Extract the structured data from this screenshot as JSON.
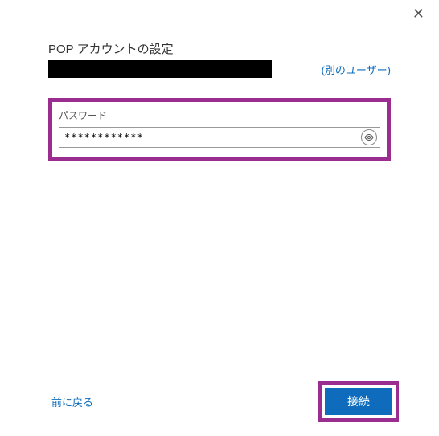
{
  "close_label": "✕",
  "title": "POP アカウントの設定",
  "other_user_label": "(別のユーザー)",
  "password": {
    "label": "パスワード",
    "value": "************"
  },
  "footer": {
    "back_label": "前に戻る",
    "connect_label": "接続"
  }
}
